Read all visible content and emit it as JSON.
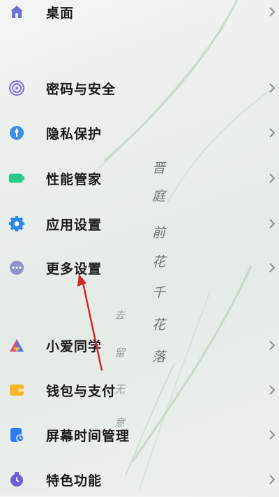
{
  "settings_menu": {
    "items": [
      {
        "label": "桌面",
        "icon": "home-icon"
      },
      {
        "label": "密码与安全",
        "icon": "fingerprint-icon"
      },
      {
        "label": "隐私保护",
        "icon": "privacy-shield-icon"
      },
      {
        "label": "性能管家",
        "icon": "battery-icon"
      },
      {
        "label": "应用设置",
        "icon": "app-settings-gear-icon"
      },
      {
        "label": "更多设置",
        "icon": "more-settings-icon"
      },
      {
        "label": "小爱同学",
        "icon": "xiaoai-assistant-icon"
      },
      {
        "label": "钱包与支付",
        "icon": "wallet-icon"
      },
      {
        "label": "屏幕时间管理",
        "icon": "screen-time-icon"
      },
      {
        "label": "特色功能",
        "icon": "special-features-icon"
      }
    ]
  },
  "wallpaper_poem": {
    "line1": [
      "晋",
      "庭",
      "前",
      "花",
      "千",
      "花",
      "落"
    ],
    "line2": [
      "去",
      "留",
      "无",
      "意"
    ]
  },
  "colors": {
    "home": "#6b6fd8",
    "fingerprint": "#7c6fe0",
    "privacy": "#3b8fe8",
    "battery": "#27c98a",
    "gear": "#2a86e8",
    "more": "#8d93c8",
    "xiaoai": "#e84a7a",
    "wallet": "#f4b62a",
    "screen_time": "#2f7cf0",
    "special": "#6a5fd6",
    "annotation_arrow": "#cc2a2a"
  }
}
